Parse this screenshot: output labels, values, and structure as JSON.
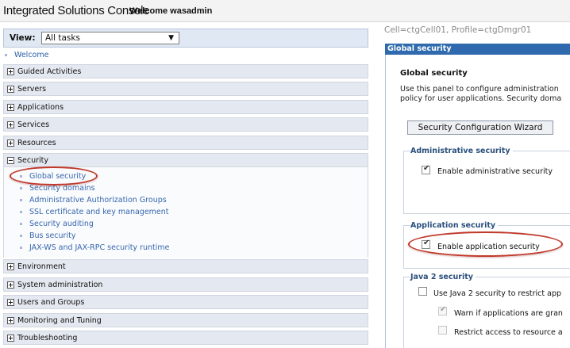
{
  "header": {
    "app_title": "Integrated Solutions Console",
    "welcome": "Welcome wasadmin"
  },
  "nav": {
    "view_label": "View:",
    "view_selected": "All tasks",
    "welcome_link": "Welcome",
    "categories": [
      {
        "label": "Guided Activities",
        "expanded": false
      },
      {
        "label": "Servers",
        "expanded": false
      },
      {
        "label": "Applications",
        "expanded": false
      },
      {
        "label": "Services",
        "expanded": false
      },
      {
        "label": "Resources",
        "expanded": false
      },
      {
        "label": "Security",
        "expanded": true
      },
      {
        "label": "Environment",
        "expanded": false
      },
      {
        "label": "System administration",
        "expanded": false
      },
      {
        "label": "Users and Groups",
        "expanded": false
      },
      {
        "label": "Monitoring and Tuning",
        "expanded": false
      },
      {
        "label": "Troubleshooting",
        "expanded": false
      }
    ],
    "security_items": [
      "Global security",
      "Security domains",
      "Administrative Authorization Groups",
      "SSL certificate and key management",
      "Security auditing",
      "Bus security",
      "JAX-WS and JAX-RPC security runtime"
    ]
  },
  "content": {
    "breadcrumb": "Cell=ctgCell01, Profile=ctgDmgr01",
    "panel_header": "Global security",
    "title": "Global security",
    "description_line1": "Use this panel to configure administration",
    "description_line2": "policy for user applications. Security doma",
    "wizard_button": "Security Configuration Wizard",
    "admin_security": {
      "legend": "Administrative security",
      "enable_label": "Enable administrative security",
      "enabled": true
    },
    "app_security": {
      "legend": "Application security",
      "enable_label": "Enable application security",
      "enabled": true
    },
    "java2_security": {
      "legend": "Java 2 security",
      "use_label": "Use Java 2 security to restrict app",
      "warn_label": "Warn if applications are gran",
      "restrict_label": "Restrict access to resource a"
    }
  },
  "colors": {
    "highlight": "#c0392b",
    "panel_header": "#2e6aad",
    "link": "#3566ad"
  }
}
